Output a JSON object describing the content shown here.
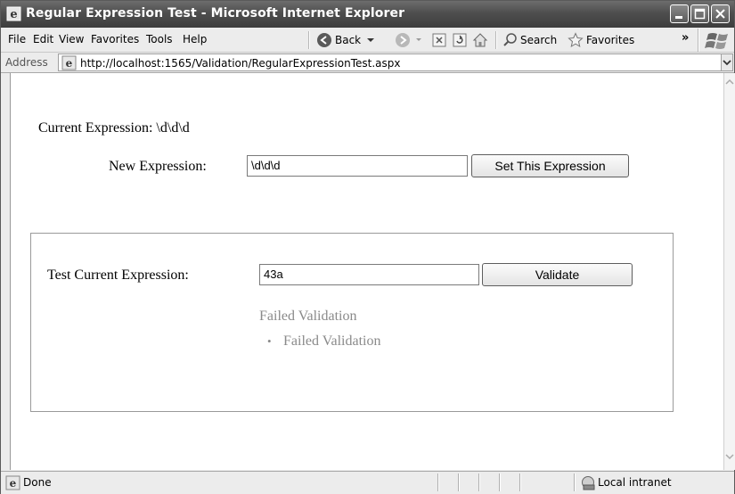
{
  "window": {
    "title": "Regular Expression Test - Microsoft Internet Explorer"
  },
  "menu": [
    "File",
    "Edit",
    "View",
    "Favorites",
    "Tools",
    "Help"
  ],
  "toolbar": {
    "back_label": "Back",
    "search_label": "Search",
    "favorites_label": "Favorites",
    "chevron": "»"
  },
  "address": {
    "label": "Address",
    "url": "http://localhost:1565/Validation/RegularExpressionTest.aspx"
  },
  "page": {
    "current_expression_label": "Current Expression: \\d\\d\\d",
    "new_expression_label": "New Expression:",
    "new_expression_value": "\\d\\d\\d",
    "set_button_label": "Set This Expression",
    "test_label": "Test Current Expression:",
    "test_value": "43a",
    "validate_button_label": "Validate",
    "validation_summary": "Failed Validation",
    "validation_errors": [
      "Failed Validation"
    ]
  },
  "status": {
    "text": "Done",
    "zone": "Local intranet"
  },
  "colors": {
    "titlebar": "#4e4e4e",
    "chrome": "#ececec",
    "validation_text": "#8a8a8a"
  }
}
